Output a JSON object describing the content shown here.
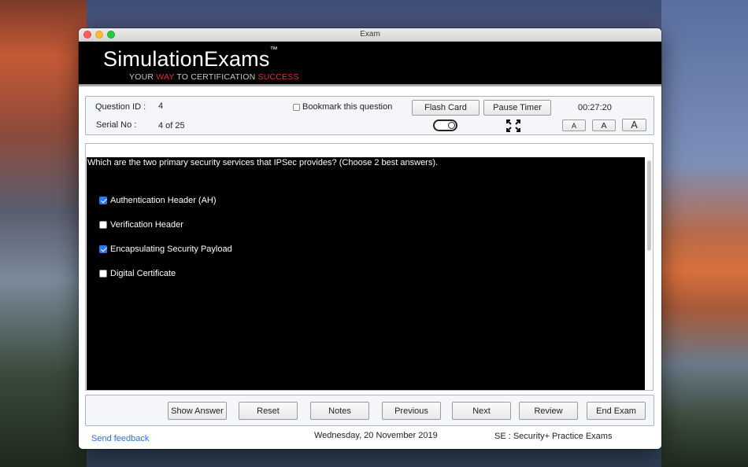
{
  "window": {
    "title": "Exam"
  },
  "brand": {
    "name": "SimulationExams",
    "tm": "™",
    "tagline_parts": [
      "YOUR ",
      "WAY",
      " TO CERTIFICATION ",
      "SUCCESS"
    ]
  },
  "info": {
    "question_id_label": "Question ID :",
    "question_id_value": "4",
    "serial_label": "Serial No :",
    "serial_value": "4 of 25",
    "bookmark_label": "Bookmark this question",
    "bookmark_checked": false,
    "flash_card_label": "Flash Card",
    "pause_timer_label": "Pause Timer",
    "timer": "00:27:20",
    "font_small": "A",
    "font_medium": "A",
    "font_large": "A"
  },
  "question": {
    "text": "Which are the two primary security services that IPSec provides? (Choose 2 best answers).",
    "options": [
      {
        "label": "Authentication Header (AH)",
        "checked": true
      },
      {
        "label": "Verification Header",
        "checked": false
      },
      {
        "label": "Encapsulating Security Payload",
        "checked": true
      },
      {
        "label": "Digital Certificate",
        "checked": false
      }
    ]
  },
  "actions": {
    "show_answer": "Show Answer",
    "reset": "Reset",
    "notes": "Notes",
    "previous": "Previous",
    "next": "Next",
    "review": "Review",
    "end_exam": "End Exam"
  },
  "footer": {
    "feedback": "Send feedback",
    "date": "Wednesday, 20 November 2019",
    "exam_name": "SE : Security+ Practice Exams"
  },
  "colors": {
    "accent_red": "#d23a2e",
    "checkbox_blue": "#2d7bf4",
    "link_blue": "#2a6fd6"
  }
}
